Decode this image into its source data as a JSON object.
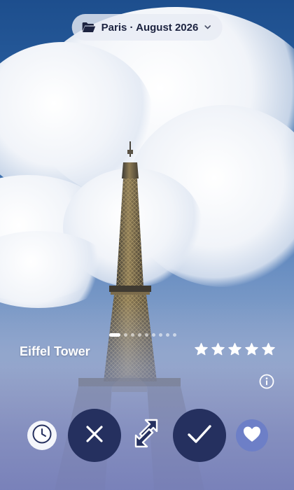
{
  "header": {
    "folder_label": "Paris · August 2026",
    "folder_icon": "folder-icon",
    "dropdown_icon": "chevron-down-icon"
  },
  "photo": {
    "title": "Eiffel Tower",
    "rating": 5,
    "rating_max": 5,
    "carousel": {
      "count": 9,
      "active_index": 0
    }
  },
  "actions": {
    "later": "clock-icon",
    "reject": "close-icon",
    "skip": "shuffle-icon",
    "accept": "check-icon",
    "favorite": "heart-icon"
  },
  "colors": {
    "pill_bg": "#e8ecf4",
    "pill_text": "#1c2340",
    "action_dark": "#25305f",
    "heart_accent": "#6d7fc7",
    "star": "#ffffff"
  }
}
